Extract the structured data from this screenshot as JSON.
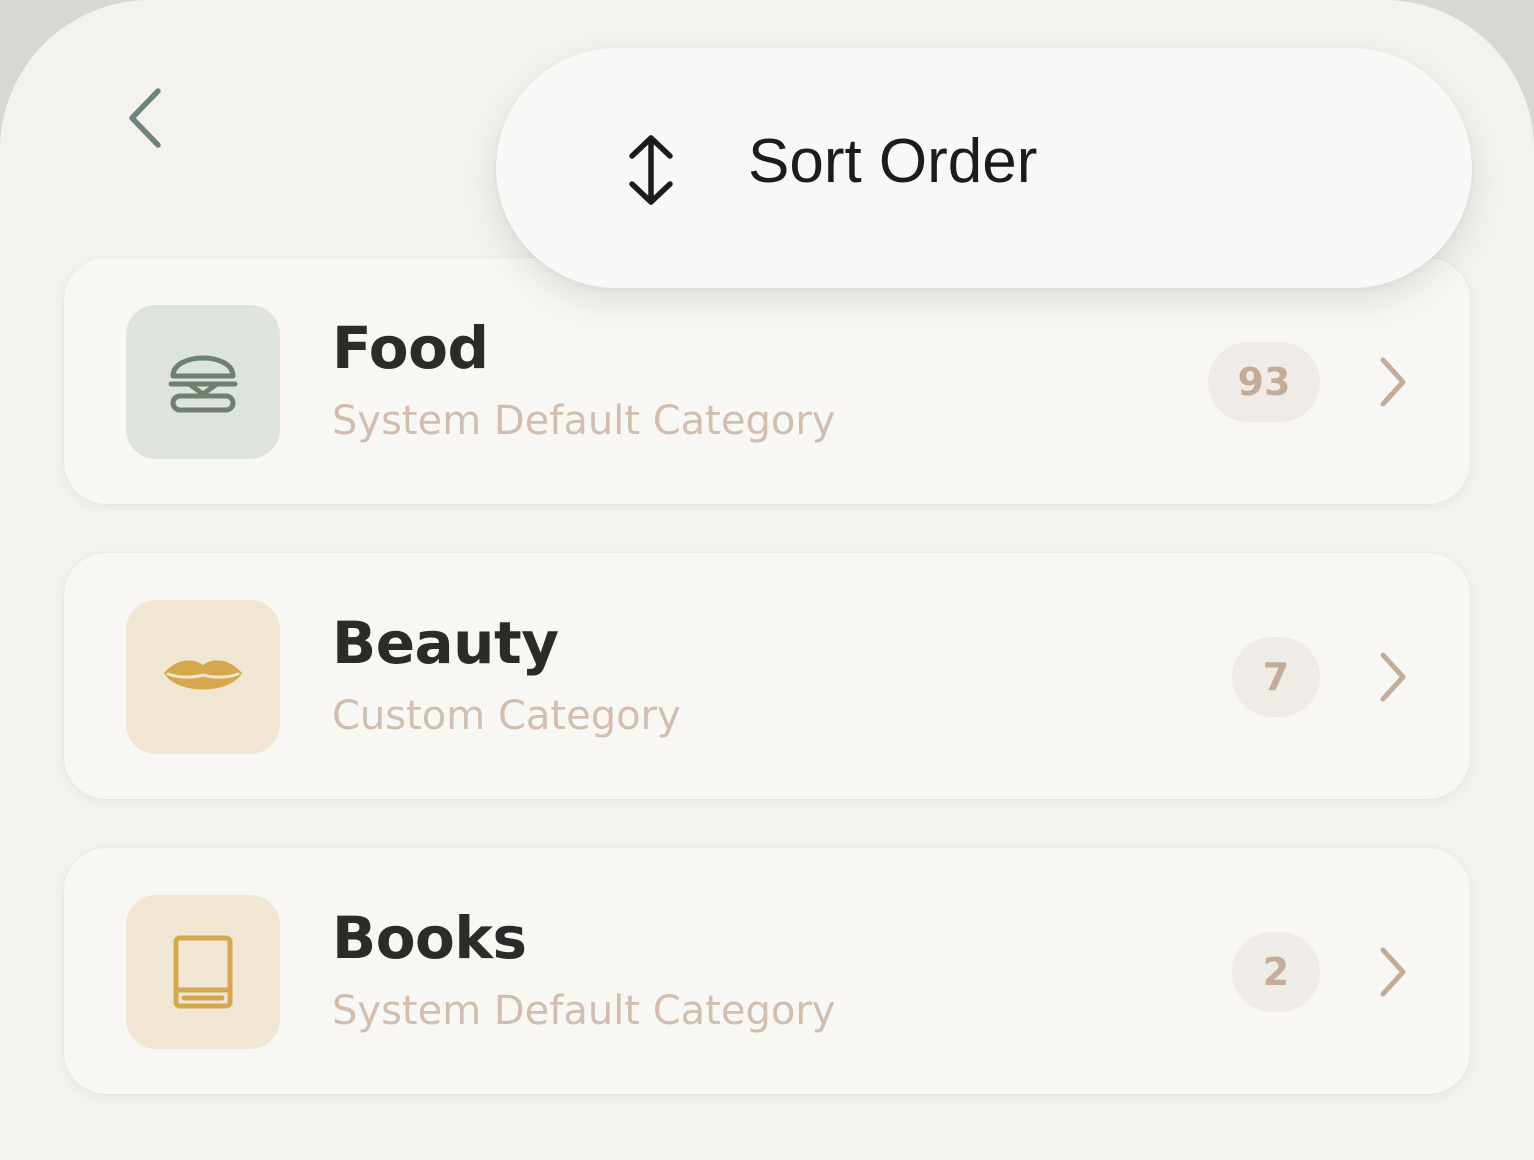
{
  "menu": {
    "sort_order_label": "Sort Order",
    "icon": "sort-arrows-icon"
  },
  "nav": {
    "back_icon": "chevron-left-icon"
  },
  "categories": [
    {
      "name": "Food",
      "subtitle": "System Default Category",
      "count": "93",
      "icon": "burger-icon",
      "tile_color": "#dfe3dd",
      "icon_color": "#6f7f72"
    },
    {
      "name": "Beauty",
      "subtitle": "Custom Category",
      "count": "7",
      "icon": "lips-icon",
      "tile_color": "#f1e6d3",
      "icon_color": "#d5a84f"
    },
    {
      "name": "Books",
      "subtitle": "System Default Category",
      "count": "2",
      "icon": "book-icon",
      "tile_color": "#f1e6d3",
      "icon_color": "#d5a84f"
    }
  ],
  "colors": {
    "background": "#f3f2ef",
    "card": "#f8f7f4",
    "title_text": "#2c2b29",
    "subtitle_text": "#d1beb0",
    "count_text": "#c4ac9b",
    "chevron": "#c4ac9b"
  }
}
